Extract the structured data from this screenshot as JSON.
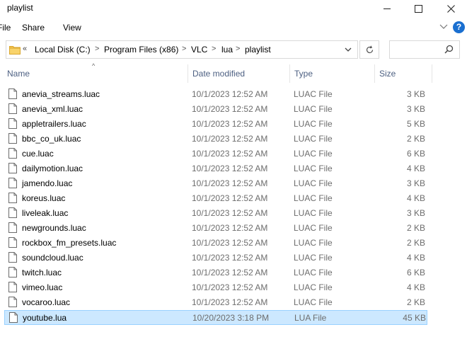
{
  "window": {
    "title": "playlist"
  },
  "ribbon": {
    "tabs": [
      "File",
      "Share",
      "View"
    ]
  },
  "address": {
    "chevron": "«",
    "crumbs": [
      "Local Disk (C:)",
      "Program Files (x86)",
      "VLC",
      "lua",
      "playlist"
    ]
  },
  "search": {
    "placeholder": ""
  },
  "columns": {
    "name": "Name",
    "date": "Date modified",
    "type": "Type",
    "size": "Size"
  },
  "files": [
    {
      "name": "anevia_streams.luac",
      "date": "10/1/2023 12:52 AM",
      "type": "LUAC File",
      "size": "3 KB"
    },
    {
      "name": "anevia_xml.luac",
      "date": "10/1/2023 12:52 AM",
      "type": "LUAC File",
      "size": "3 KB"
    },
    {
      "name": "appletrailers.luac",
      "date": "10/1/2023 12:52 AM",
      "type": "LUAC File",
      "size": "5 KB"
    },
    {
      "name": "bbc_co_uk.luac",
      "date": "10/1/2023 12:52 AM",
      "type": "LUAC File",
      "size": "2 KB"
    },
    {
      "name": "cue.luac",
      "date": "10/1/2023 12:52 AM",
      "type": "LUAC File",
      "size": "6 KB"
    },
    {
      "name": "dailymotion.luac",
      "date": "10/1/2023 12:52 AM",
      "type": "LUAC File",
      "size": "4 KB"
    },
    {
      "name": "jamendo.luac",
      "date": "10/1/2023 12:52 AM",
      "type": "LUAC File",
      "size": "3 KB"
    },
    {
      "name": "koreus.luac",
      "date": "10/1/2023 12:52 AM",
      "type": "LUAC File",
      "size": "4 KB"
    },
    {
      "name": "liveleak.luac",
      "date": "10/1/2023 12:52 AM",
      "type": "LUAC File",
      "size": "3 KB"
    },
    {
      "name": "newgrounds.luac",
      "date": "10/1/2023 12:52 AM",
      "type": "LUAC File",
      "size": "2 KB"
    },
    {
      "name": "rockbox_fm_presets.luac",
      "date": "10/1/2023 12:52 AM",
      "type": "LUAC File",
      "size": "2 KB"
    },
    {
      "name": "soundcloud.luac",
      "date": "10/1/2023 12:52 AM",
      "type": "LUAC File",
      "size": "4 KB"
    },
    {
      "name": "twitch.luac",
      "date": "10/1/2023 12:52 AM",
      "type": "LUAC File",
      "size": "6 KB"
    },
    {
      "name": "vimeo.luac",
      "date": "10/1/2023 12:52 AM",
      "type": "LUAC File",
      "size": "4 KB"
    },
    {
      "name": "vocaroo.luac",
      "date": "10/1/2023 12:52 AM",
      "type": "LUAC File",
      "size": "2 KB"
    },
    {
      "name": "youtube.lua",
      "date": "10/20/2023 3:18 PM",
      "type": "LUA File",
      "size": "45 KB",
      "selected": true
    }
  ],
  "colors": {
    "selection_bg": "#cce8ff",
    "selection_border": "#99d1ff",
    "header_text": "#4d6082",
    "folder": "#f5c451"
  },
  "icons": {
    "folder": "folder-icon",
    "file": "file-icon",
    "search": "search-icon",
    "refresh": "refresh-icon",
    "help": "help-icon"
  }
}
